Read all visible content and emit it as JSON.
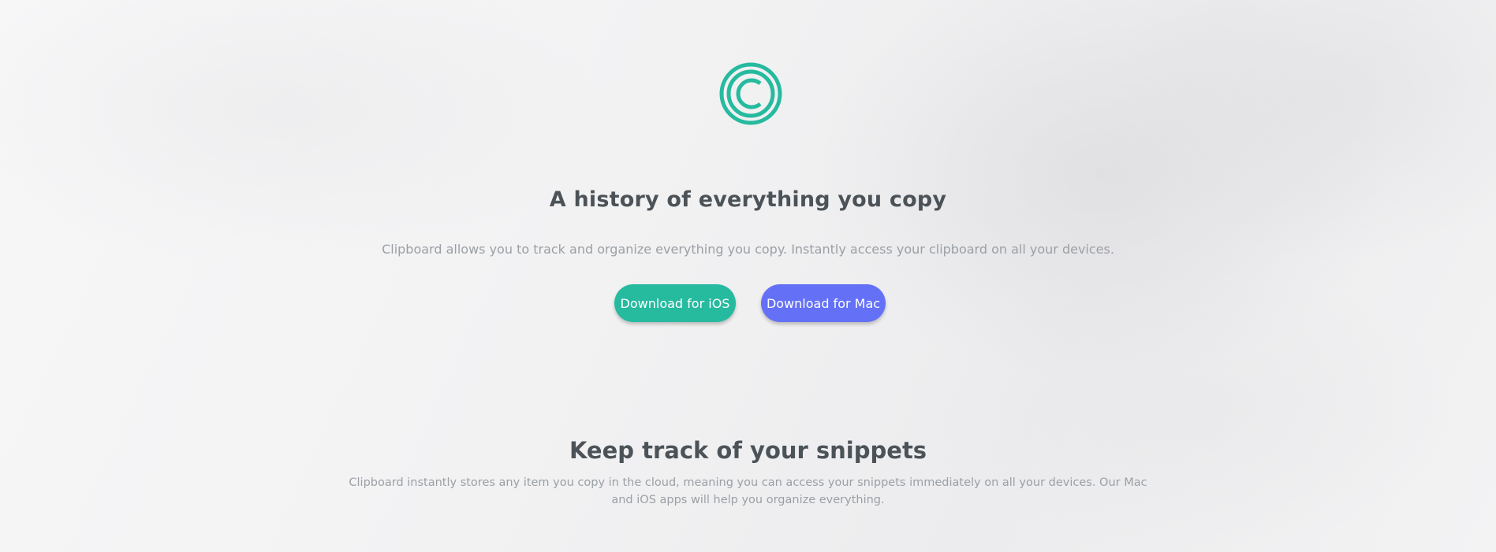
{
  "brand": {
    "logo_icon": "copyright-c-logo-icon",
    "accent_color": "#26ba9f",
    "secondary_color": "#6470f6"
  },
  "hero": {
    "title": "A history of everything you copy",
    "subtitle": "Clipboard allows you to track and organize everything you copy. Instantly access your clipboard on all your devices.",
    "buttons": {
      "ios_label": "Download for iOS",
      "mac_label": "Download for Mac"
    }
  },
  "snippets_section": {
    "title": "Keep track of your snippets",
    "body": "Clipboard instantly stores any item you copy in the cloud, meaning you can access your snippets immediately on all your devices. Our Mac and iOS apps will help you organize everything."
  }
}
